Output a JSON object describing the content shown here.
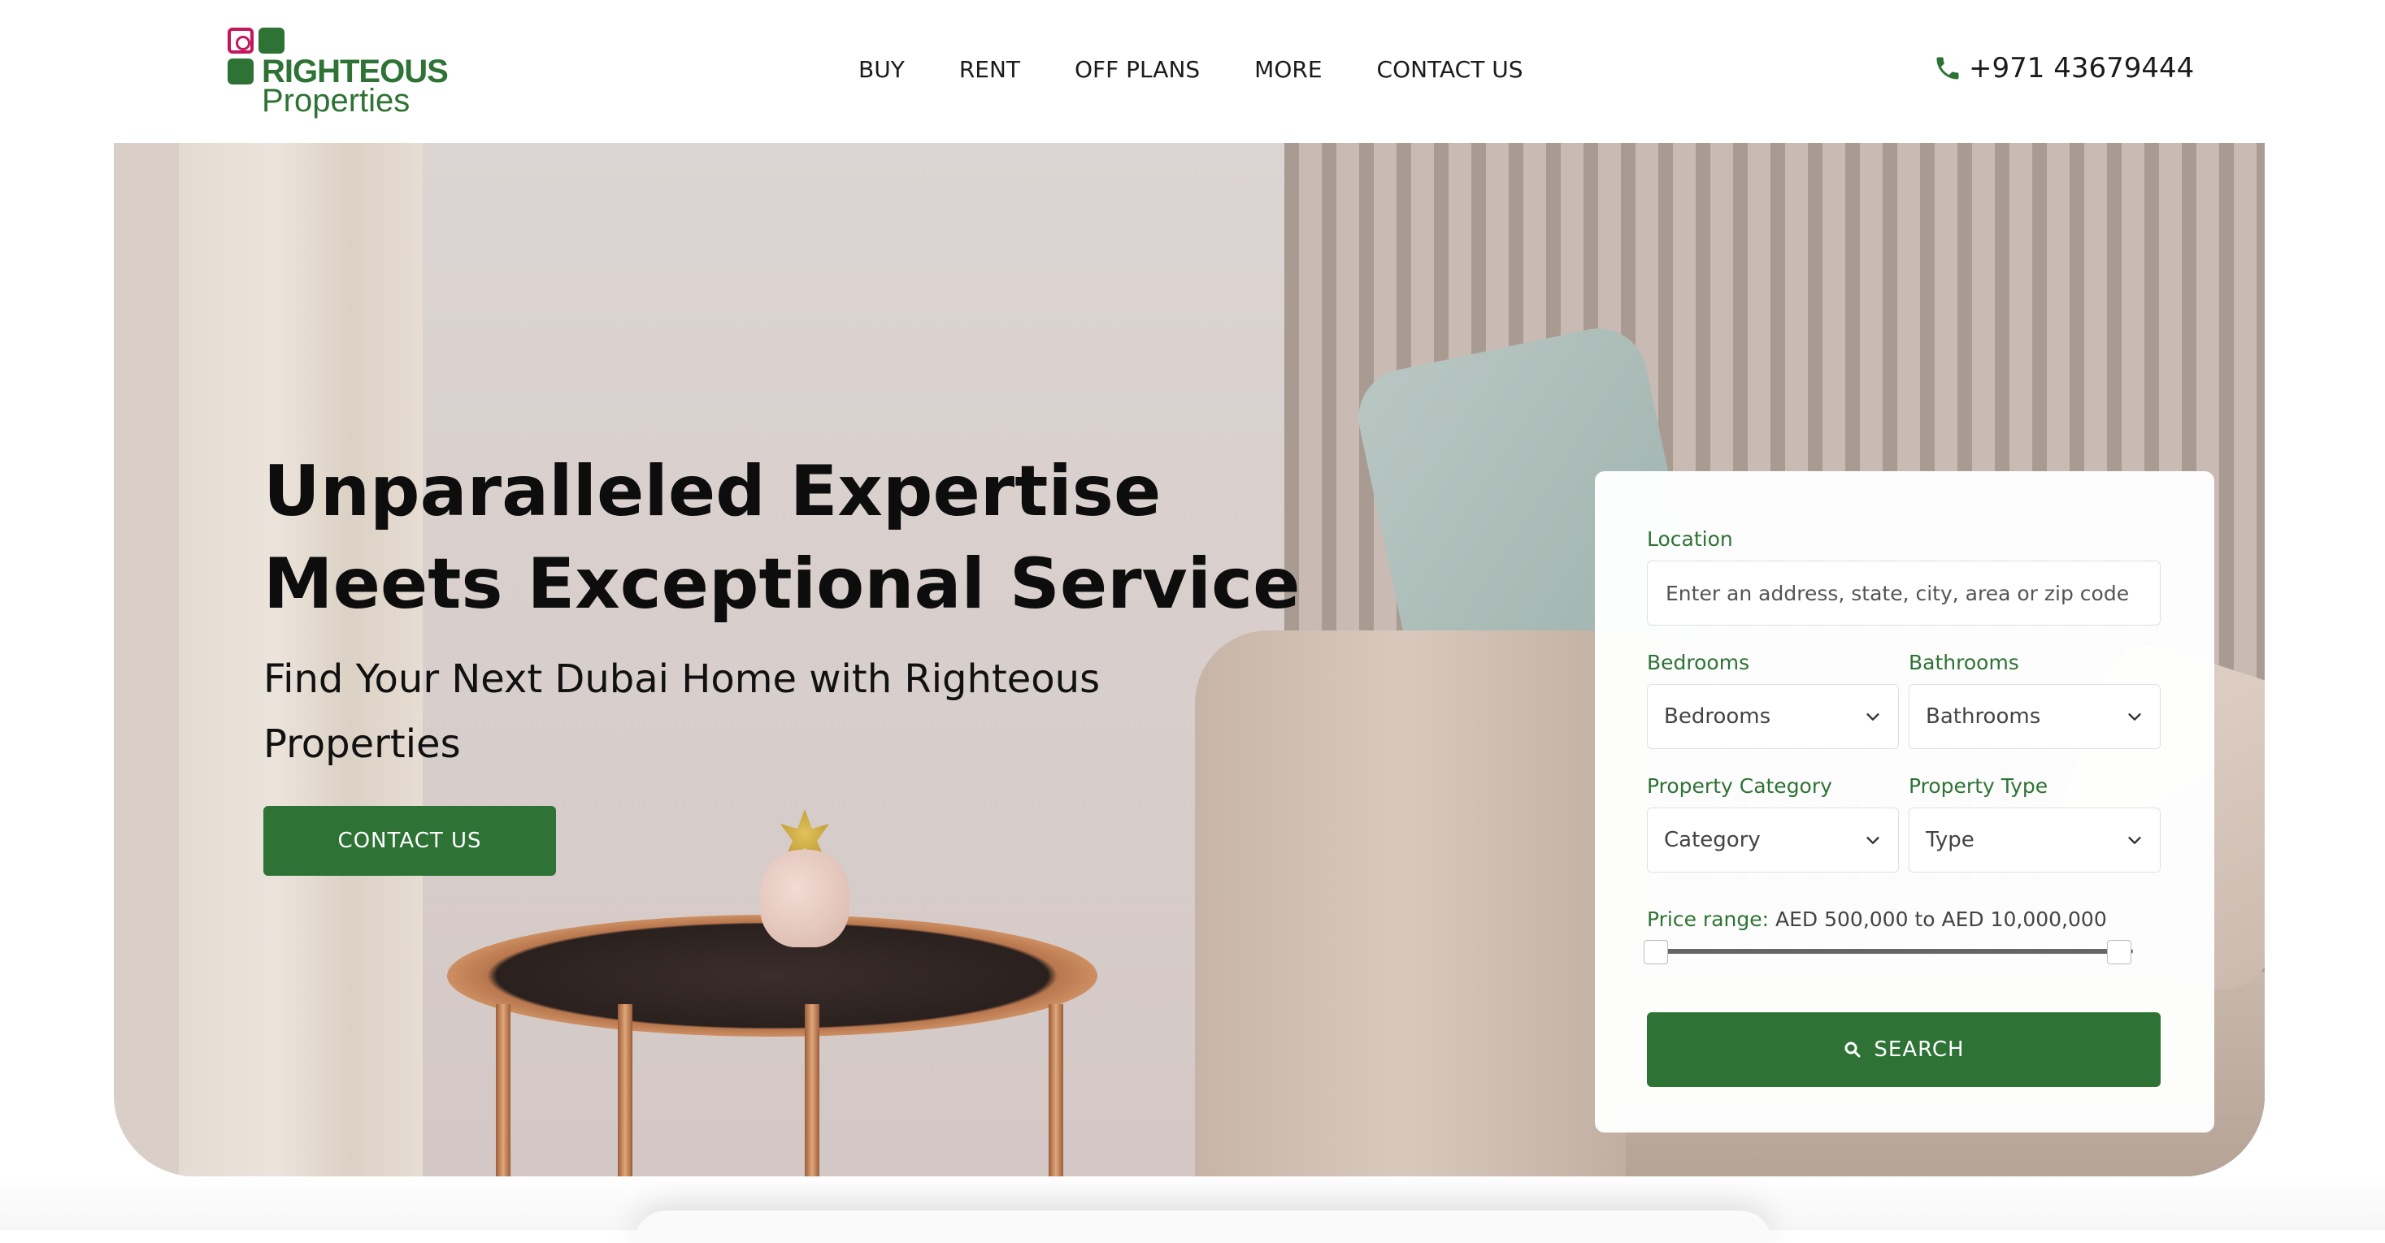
{
  "brand": {
    "name_top": "RIGHTEOUS",
    "name_bottom": "Properties",
    "primary_color": "#2e7335",
    "accent_color": "#c2185b"
  },
  "nav": {
    "items": [
      {
        "label": "BUY"
      },
      {
        "label": "RENT"
      },
      {
        "label": "OFF PLANS"
      },
      {
        "label": "MORE"
      },
      {
        "label": "CONTACT US"
      }
    ]
  },
  "header": {
    "phone": "+971 43679444",
    "phone_icon": "phone-icon"
  },
  "hero": {
    "title": "Unparalleled Expertise Meets Exceptional Service",
    "subtitle": "Find Your Next Dubai Home with Righteous Properties",
    "cta_label": "CONTACT US"
  },
  "search": {
    "location_label": "Location",
    "location_placeholder": "Enter an address, state, city, area or zip code",
    "bedrooms_label": "Bedrooms",
    "bedrooms_value": "Bedrooms",
    "bathrooms_label": "Bathrooms",
    "bathrooms_value": "Bathrooms",
    "category_label": "Property Category",
    "category_value": "Category",
    "type_label": "Property Type",
    "type_value": "Type",
    "price_label": "Price range:",
    "price_value": "AED 500,000 to AED 10,000,000",
    "price_min_fraction": 0,
    "price_max_fraction": 1,
    "button_label": "SEARCH",
    "button_icon": "search-icon"
  }
}
